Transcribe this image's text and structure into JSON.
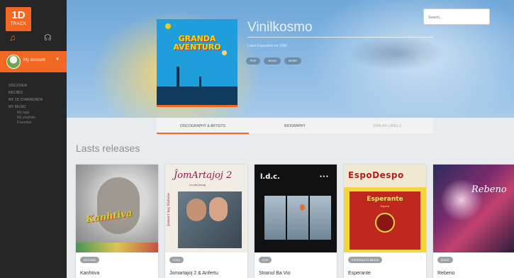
{
  "brand": {
    "logo_big": "1D",
    "logo_small": "TRACK"
  },
  "sidebar": {
    "account_label": "My account",
    "account_caret": "▼",
    "icons": [
      "music-note-icon",
      "headphones-icon"
    ],
    "nav": [
      "DISCOVER",
      "RECIBIS",
      "MY 1D STARMONDA",
      "MY MUSIC"
    ],
    "subnav": [
      "My tags",
      "My playlists",
      "Favorites"
    ]
  },
  "search": {
    "placeholder": "Search..."
  },
  "artist": {
    "name": "Vinilkosmo",
    "subtitle": "Label Esperanto en 1990",
    "tags": [
      "POP",
      "ROCK",
      "MORE"
    ]
  },
  "cover": {
    "line1": "GRANDA",
    "line2": "AVENTURO"
  },
  "tabs": [
    {
      "label": "DISCOGRAPHY & ARTISTS",
      "state": "active"
    },
    {
      "label": "BIOGRAPHY",
      "state": "normal"
    },
    {
      "label": "SIMILAR LABELS",
      "state": "disabled"
    }
  ],
  "section": {
    "title": "Lasts releases"
  },
  "releases": [
    {
      "badge": "REGGAE",
      "name": "Kanhtiva",
      "art_text": "Kanhtiva"
    },
    {
      "badge": "FOLK",
      "name": "Ĵomartajoj 2 & Anfertu",
      "art_text": "ĴomArtajoj 2",
      "art_sub": "La plej bonaj",
      "art_side": "Jomarr kaj Natalie"
    },
    {
      "badge": "POP",
      "name": "Stranul Ba Vio",
      "art_text": "l.d.c."
    },
    {
      "badge": "ESPERANTO MUSIK",
      "name": "Esperante",
      "art_text": "EspoDespo",
      "art_sub": "Esperante",
      "art_small": "Espere"
    },
    {
      "badge": "ROCK",
      "name": "Rebeno",
      "art_text": "Rebeno"
    }
  ],
  "colors": {
    "accent": "#f26722",
    "sidebar": "#262626",
    "sky": "#8dbbe4"
  }
}
